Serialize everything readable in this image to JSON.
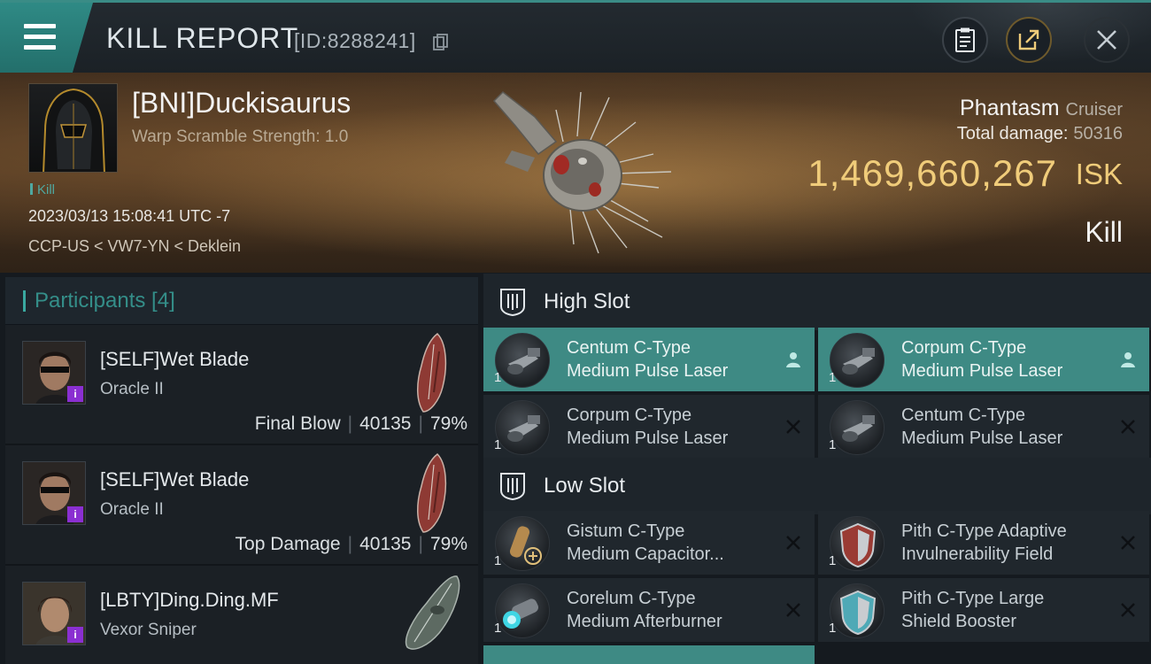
{
  "header": {
    "title": "KILL REPORT",
    "report_id": "[ID:8288241]"
  },
  "victim": {
    "name": "[BNI]Duckisaurus",
    "warp_scramble": "Warp Scramble Strength: 1.0",
    "tag": "Kill",
    "datetime": "2023/03/13 15:08:41 UTC -7",
    "location": "CCP-US < VW7-YN < Deklein",
    "ship_name": "Phantasm",
    "ship_class": "Cruiser",
    "total_damage_label": "Total damage:",
    "total_damage": "50316",
    "isk_value": "1,469,660,267",
    "isk_unit": "ISK",
    "result": "Kill"
  },
  "participants": {
    "label": "Participants [4]",
    "items": [
      {
        "name": "[SELF]Wet Blade",
        "ship": "Oracle II",
        "role": "Final Blow",
        "damage": "40135",
        "percent": "79%",
        "badge": "i"
      },
      {
        "name": "[SELF]Wet Blade",
        "ship": "Oracle II",
        "role": "Top Damage",
        "damage": "40135",
        "percent": "79%",
        "badge": "i"
      },
      {
        "name": "[LBTY]Ding.Ding.MF",
        "ship": "Vexor Sniper",
        "badge": "i"
      }
    ]
  },
  "high_slot": {
    "label": "High Slot",
    "modules": [
      {
        "line1": "Centum C-Type",
        "line2": "Medium Pulse Laser",
        "qty": "1",
        "status": "person-icon",
        "highlight": true
      },
      {
        "line1": "Corpum C-Type",
        "line2": "Medium Pulse Laser",
        "qty": "1",
        "status": "person-icon",
        "highlight": true
      },
      {
        "line1": "Corpum C-Type",
        "line2": "Medium Pulse Laser",
        "qty": "1",
        "status": "destroyed-icon",
        "highlight": false
      },
      {
        "line1": "Centum C-Type",
        "line2": "Medium Pulse Laser",
        "qty": "1",
        "status": "destroyed-icon",
        "highlight": false
      }
    ]
  },
  "low_slot": {
    "label": "Low Slot",
    "modules": [
      {
        "line1": "Gistum C-Type",
        "line2": "Medium Capacitor...",
        "qty": "1",
        "status": "destroyed-icon"
      },
      {
        "line1": "Pith C-Type Adaptive",
        "line2": "Invulnerability Field",
        "qty": "1",
        "status": "destroyed-icon"
      },
      {
        "line1": "Corelum C-Type",
        "line2": "Medium Afterburner",
        "qty": "1",
        "status": "destroyed-icon"
      },
      {
        "line1": "Pith C-Type Large",
        "line2": "Shield Booster",
        "qty": "1",
        "status": "destroyed-icon"
      }
    ]
  },
  "colors": {
    "accent_teal": "#3e8a84",
    "isk_gold": "#f0cc7a",
    "badge_purple": "#8a2fd1"
  }
}
